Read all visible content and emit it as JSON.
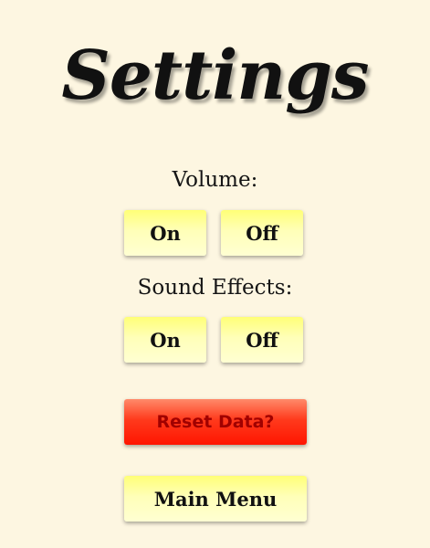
{
  "screen": {
    "title": "Settings"
  },
  "volume": {
    "label": "Volume:",
    "on_label": "On",
    "off_label": "Off"
  },
  "sound_effects": {
    "label": "Sound Effects:",
    "on_label": "On",
    "off_label": "Off"
  },
  "actions": {
    "reset_label": "Reset Data?",
    "main_menu_label": "Main Menu"
  },
  "colors": {
    "background": "#fdf6e1",
    "button_yellow": "#ffff77",
    "button_light": "#ffffd2",
    "reset_red": "#ff1500",
    "reset_text": "#a00000"
  }
}
